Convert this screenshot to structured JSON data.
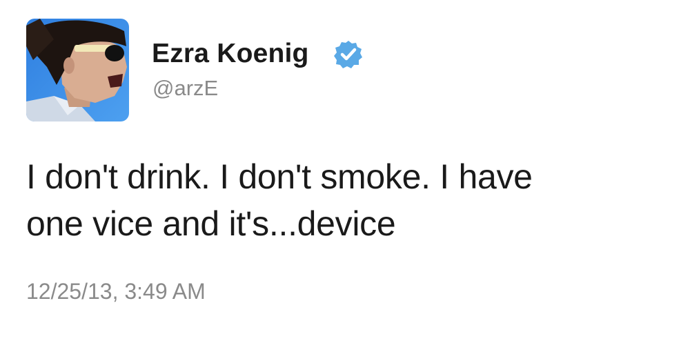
{
  "author": {
    "display_name": "Ezra Koenig",
    "handle": "@arzE",
    "verified": true,
    "avatar_icon": "profile-photo"
  },
  "tweet": {
    "text_lines": [
      "I don't drink. I don't smoke. I have",
      "one vice and it's...device"
    ],
    "timestamp": "12/25/13, 3:49 AM"
  },
  "colors": {
    "text": "#1a1a1a",
    "secondary_text": "#8a8a8a",
    "verified_badge": "#5aa9e6",
    "background": "#ffffff"
  }
}
